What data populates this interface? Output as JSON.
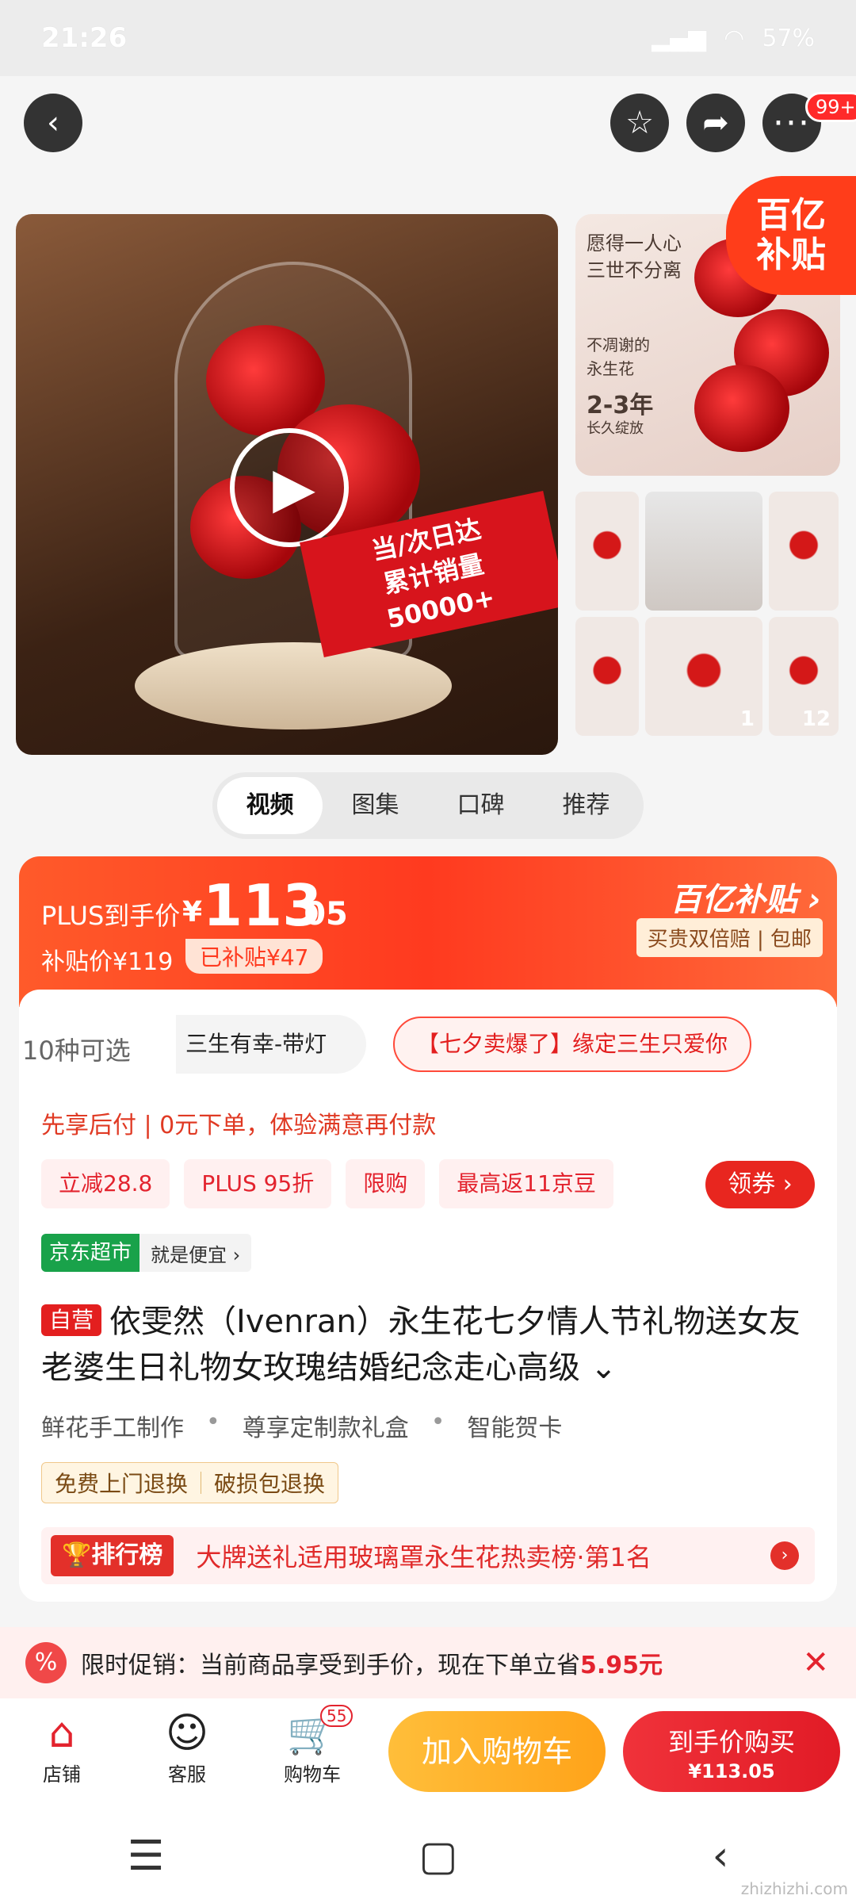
{
  "status_bar": {
    "time": "21:26",
    "battery": "57%"
  },
  "nav": {
    "more_badge": "99+"
  },
  "gallery": {
    "promo_line1": "当/次日达",
    "promo_line2": "累计销量50000+",
    "side_title": "愿得一人心\n三世不分离",
    "side_sub": "不凋谢的\n永生花",
    "side_years": "2-3年",
    "side_years_sub": "长久绽放",
    "yi_badge_line1": "百亿",
    "yi_badge_line2": "补贴",
    "thumb_num_1": "1",
    "thumb_num_2": "12"
  },
  "tabs": [
    "视频",
    "图集",
    "口碑",
    "推荐"
  ],
  "price": {
    "plus_label": "PLUS到手价",
    "yen": "¥",
    "integer": "113",
    "decimal": ".05",
    "sub_price": "补贴价¥119",
    "subsidy_tag": "已补贴¥47",
    "yi_logo": "百亿补贴 ›",
    "yi_sub": "买贵双倍赔 | 包邮"
  },
  "options": {
    "count": "10种可选",
    "chip1": "三生有幸-带灯",
    "chip2": "【七夕卖爆了】缘定三生只爱你"
  },
  "pay_later": "先享后付 | 0元下单，体验满意再付款",
  "tags": [
    "立减28.8",
    "PLUS 95折",
    "限购",
    "最高返11京豆"
  ],
  "coupon": "领券 ›",
  "jd": {
    "label": "京东超市",
    "text": "就是便宜 ›"
  },
  "title": {
    "self_tag": "自营",
    "text": "依雯然（Ivenran）永生花七夕情人节礼物送女友老婆生日礼物女玫瑰结婚纪念走心高级 ⌄"
  },
  "features": [
    "鲜花手工制作",
    "尊享定制款礼盒",
    "智能贺卡"
  ],
  "returns": [
    "免费上门退换",
    "破损包退换"
  ],
  "rank": {
    "label": "🏆排行榜",
    "text": "大牌送礼适用玻璃罩永生花热卖榜·第1名"
  },
  "promo": {
    "text": "限时促销：当前商品享受到手价，现在下单立省",
    "amount": "5.95元"
  },
  "actions": {
    "shop": "店铺",
    "service": "客服",
    "cart": "购物车",
    "cart_badge": "55",
    "add_cart": "加入购物车",
    "buy_line1": "到手价购买",
    "buy_line2": "¥113.05"
  },
  "watermark": "zhizhizhi.com"
}
